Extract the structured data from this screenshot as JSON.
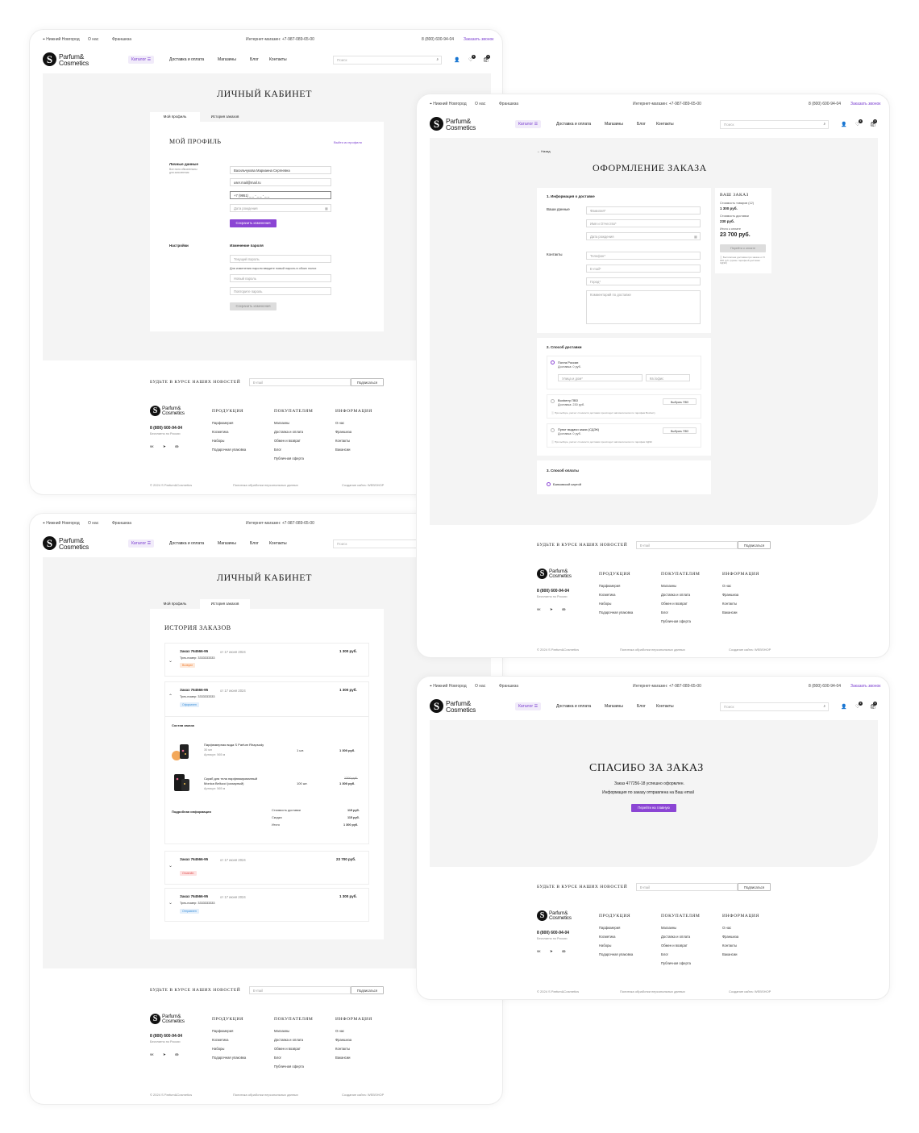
{
  "header": {
    "city": "Нижний Новгород",
    "about": "О нас",
    "franchise": "Франшиза",
    "shop_phone": "Интернет-магазин: +7-987-089-65-00",
    "phone": "8 (800) 600-94-04",
    "callback": "Заказать звонок",
    "logo_top": "Parfum&",
    "logo_bottom": "Cosmetics",
    "catalog": "Каталог",
    "nav": [
      "Доставка и оплата",
      "Магазины",
      "Блог",
      "Контакты"
    ],
    "search_placeholder": "Поиск",
    "cart_count": "3",
    "fav_count": "3",
    "colors": {
      "accent": "#8b45d4",
      "bg": "#f4f4f4"
    }
  },
  "profile": {
    "title": "ЛИЧНЫЙ КАБИНЕТ",
    "tab_profile": "Мой профиль",
    "tab_history": "История заказов",
    "heading": "МОЙ ПРОФИЛЬ",
    "logout": "Выйти из профиля",
    "personal_label": "Личные данные",
    "personal_note": "Все поля обязательны для заполнения",
    "name": "Васильчукова Марианна Сергеевна",
    "email": "user.mail@mail.ru",
    "phone": "+7 (9951) _ _ - _ _ - _ _",
    "birth": "Дата рождения",
    "save": "Сохранить изменения",
    "settings": "Настройки",
    "change_pw": "Изменение пароля",
    "current_pw": "Текущий пароль",
    "pw_note": "Для изменения пароля введите новый пароль в обоих полях",
    "new_pw": "Новый пароль",
    "repeat_pw": "Повторите пароль",
    "save2": "Сохранить изменения"
  },
  "newsletter": {
    "title": "БУДЬТЕ В КУРСЕ НАШИХ НОВОСТЕЙ",
    "placeholder": "E-mail",
    "button": "Подписаться"
  },
  "footer": {
    "phone": "8 (800) 600-94-04",
    "free": "Бесплатно по России",
    "col1_title": "ПРОДУКЦИЯ",
    "col1": [
      "Парфюмерия",
      "Косметика",
      "Наборы",
      "Подарочная упаковка"
    ],
    "col2_title": "ПОКУПАТЕЛЯМ",
    "col2": [
      "Магазины",
      "Доставка и оплата",
      "Обмен и возврат",
      "Блог",
      "Публичная оферта"
    ],
    "col3_title": "ИНФОРМАЦИЯ",
    "col3": [
      "О нас",
      "Франшиза",
      "Контакты",
      "Вакансии"
    ],
    "copyright": "© 2024 S Parfum&Cosmetics",
    "policy": "Политика обработки персональных данных",
    "made": "Создание сайта: WEBSHOP"
  },
  "checkout": {
    "back": "Назад",
    "title": "ОФОРМЛЕНИЕ ЗАКАЗА",
    "s1": "1. Информация о доставке",
    "your_data": "Ваши данные",
    "surname": "Фамилия*",
    "name": "Имя и Отчество*",
    "birth": "Дата рождения",
    "contacts": "Контакты",
    "tel": "Телефон*",
    "email": "E-mail*",
    "city": "Город*",
    "comment": "Комментарий по доставке",
    "s2": "2. Способ доставки",
    "post": "Почта России",
    "post_price": "Доставка: 0 руб.",
    "street": "Улица и дом*",
    "apt": "Кв./офис",
    "boxberry": "Boxberry ПВЗ",
    "boxberry_price": "Доставка: 230 руб.",
    "choose": "Выбрать ПВЗ",
    "boxberry_note": "При выборе, расчет стоимости доставки происходит автоматически по тарифам Boxberry",
    "cdek": "Пункт выдачи заказ (СДЭК)",
    "cdek_price": "Доставка: 0 руб.",
    "choose2": "Выбрать ПВЗ",
    "cdek_note": "При выборе, расчет стоимости доставки происходит автоматически по тарифам СДЭК",
    "s3": "3. Способ оплаты",
    "card": "Банковской картой",
    "summary_title": "ВАШ ЗАКАЗ",
    "goods_label": "Стоимость товаров (12)",
    "goods": "1 300 руб.",
    "delivery_label": "Стоимость доставки",
    "delivery": "230 руб.",
    "total_label": "Итого к оплате",
    "total": "23 700 руб.",
    "pay": "Перейти к оплате",
    "free_note": "Бесплатная доставка при заказе от 8 000 руб. (кроме тарифной доставки СДЭК)"
  },
  "history": {
    "title": "ЛИЧНЫЙ КАБИНЕТ",
    "heading": "ИСТОРИЯ ЗАКАЗОВ",
    "orders": [
      {
        "num": "Заказ 764566-95",
        "date": "от 17 июня 2024",
        "price": "1 300 руб.",
        "track": "Трек-номер: 3333333333",
        "status": "Возврат",
        "color": "#f07a2e"
      },
      {
        "num": "Заказ 764566-95",
        "date": "от 17 июня 2024",
        "price": "1 300 руб.",
        "track": "Трек-номер: 3333333333",
        "status": "Оформлен",
        "color": "#3a8fd9"
      },
      {
        "num": "Заказ 764566-95",
        "date": "от 17 июня 2024",
        "price": "23 700 руб.",
        "track": "",
        "status": "Отменён",
        "color": "#e04848"
      },
      {
        "num": "Заказ 764566-95",
        "date": "от 17 июня 2024",
        "price": "1 300 руб.",
        "track": "Трек-номер: 3333333333",
        "status": "Отправлен",
        "color": "#3a8fd9"
      }
    ],
    "composition": "Состав заказа",
    "item1_name": "Парфюмерная вода S Parfum Rhapsody",
    "item1_vol": "30 мл",
    "item1_art": "Артикул: 565 м",
    "item1_qty": "1 шт.",
    "item1_price": "1 300 руб.",
    "item2_name1": "Скраб для тела парфюмированный",
    "item2_name2": "Monica Bellucci (сахарный)",
    "item2_art": "Артикул: 565 м",
    "item2_qty": "100 шт.",
    "item2_old": "1300 руб.",
    "item2_price": "1 300 руб.",
    "details": "Подробная информация",
    "d1": "Стоимость доставки",
    "d1v": "115 руб.",
    "d2": "Скидка",
    "d2v": "115 руб.",
    "d3": "Итого",
    "d3v": "1 300 руб."
  },
  "thanks": {
    "title": "СПАСИБО ЗА ЗАКАЗ",
    "line1": "Заказ 477256-18 успешно оформлен.",
    "line2": "Информация по заказу отправлена на Ваш email",
    "button": "Перейти на главную"
  }
}
